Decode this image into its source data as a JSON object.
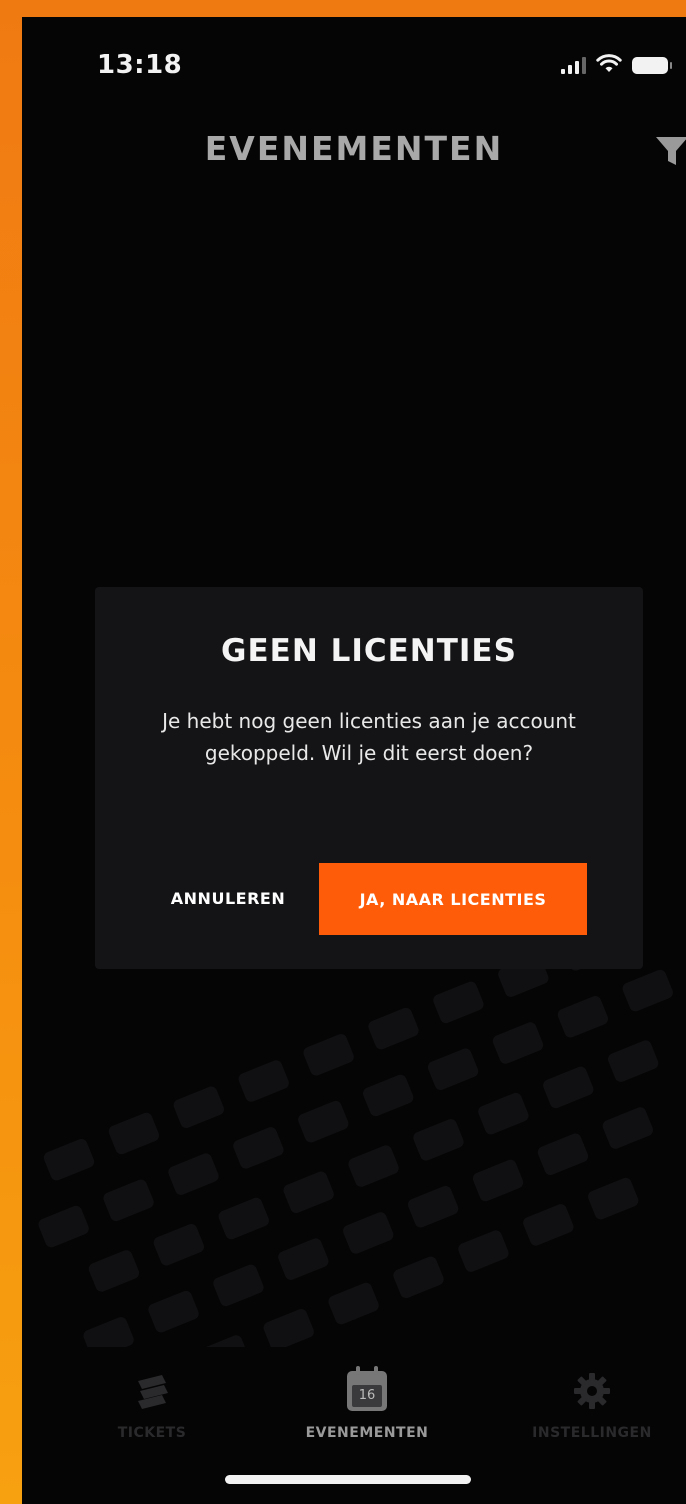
{
  "status_bar": {
    "time": "13:18"
  },
  "header": {
    "title": "EVENEMENTEN"
  },
  "dialog": {
    "title": "GEEN LICENTIES",
    "message": "Je hebt nog geen licenties aan je account gekoppeld. Wil je dit eerst doen?",
    "cancel_label": "ANNULEREN",
    "confirm_label": "JA, NAAR LICENTIES"
  },
  "tab_bar": {
    "tickets_label": "TICKETS",
    "events_label": "EVENEMENTEN",
    "events_icon_date": "16",
    "settings_label": "INSTELLINGEN"
  },
  "colors": {
    "accent": "#ff5c0a",
    "background": "#050506",
    "dialog": "#141416",
    "frame": "#f58d10"
  },
  "icons": [
    "filter-icon",
    "ticket-icon",
    "calendar-icon",
    "gear-icon",
    "wifi-icon",
    "battery-icon",
    "signal-icon"
  ]
}
